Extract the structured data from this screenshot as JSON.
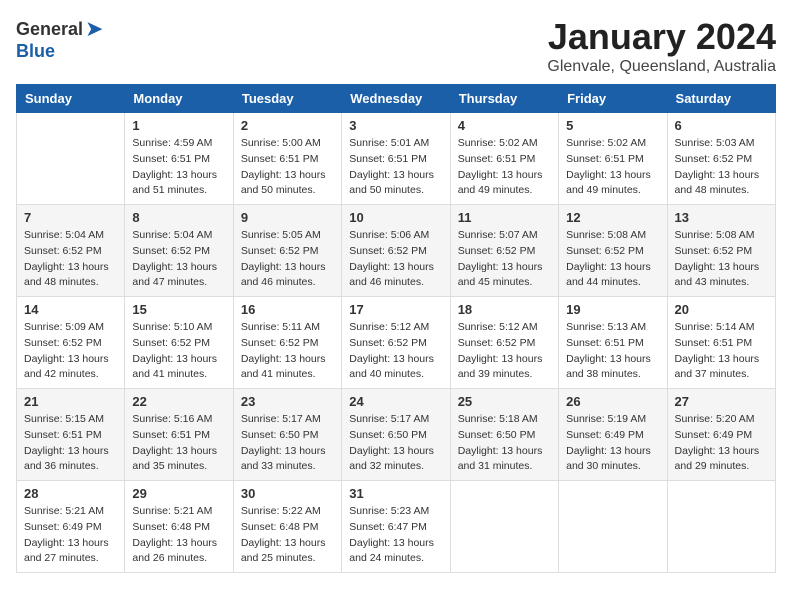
{
  "header": {
    "logo_general": "General",
    "logo_blue": "Blue",
    "month_title": "January 2024",
    "location": "Glenvale, Queensland, Australia"
  },
  "weekdays": [
    "Sunday",
    "Monday",
    "Tuesday",
    "Wednesday",
    "Thursday",
    "Friday",
    "Saturday"
  ],
  "weeks": [
    [
      {
        "day": "",
        "sunrise": "",
        "sunset": "",
        "daylight": ""
      },
      {
        "day": "1",
        "sunrise": "Sunrise: 4:59 AM",
        "sunset": "Sunset: 6:51 PM",
        "daylight": "Daylight: 13 hours and 51 minutes."
      },
      {
        "day": "2",
        "sunrise": "Sunrise: 5:00 AM",
        "sunset": "Sunset: 6:51 PM",
        "daylight": "Daylight: 13 hours and 50 minutes."
      },
      {
        "day": "3",
        "sunrise": "Sunrise: 5:01 AM",
        "sunset": "Sunset: 6:51 PM",
        "daylight": "Daylight: 13 hours and 50 minutes."
      },
      {
        "day": "4",
        "sunrise": "Sunrise: 5:02 AM",
        "sunset": "Sunset: 6:51 PM",
        "daylight": "Daylight: 13 hours and 49 minutes."
      },
      {
        "day": "5",
        "sunrise": "Sunrise: 5:02 AM",
        "sunset": "Sunset: 6:51 PM",
        "daylight": "Daylight: 13 hours and 49 minutes."
      },
      {
        "day": "6",
        "sunrise": "Sunrise: 5:03 AM",
        "sunset": "Sunset: 6:52 PM",
        "daylight": "Daylight: 13 hours and 48 minutes."
      }
    ],
    [
      {
        "day": "7",
        "sunrise": "Sunrise: 5:04 AM",
        "sunset": "Sunset: 6:52 PM",
        "daylight": "Daylight: 13 hours and 48 minutes."
      },
      {
        "day": "8",
        "sunrise": "Sunrise: 5:04 AM",
        "sunset": "Sunset: 6:52 PM",
        "daylight": "Daylight: 13 hours and 47 minutes."
      },
      {
        "day": "9",
        "sunrise": "Sunrise: 5:05 AM",
        "sunset": "Sunset: 6:52 PM",
        "daylight": "Daylight: 13 hours and 46 minutes."
      },
      {
        "day": "10",
        "sunrise": "Sunrise: 5:06 AM",
        "sunset": "Sunset: 6:52 PM",
        "daylight": "Daylight: 13 hours and 46 minutes."
      },
      {
        "day": "11",
        "sunrise": "Sunrise: 5:07 AM",
        "sunset": "Sunset: 6:52 PM",
        "daylight": "Daylight: 13 hours and 45 minutes."
      },
      {
        "day": "12",
        "sunrise": "Sunrise: 5:08 AM",
        "sunset": "Sunset: 6:52 PM",
        "daylight": "Daylight: 13 hours and 44 minutes."
      },
      {
        "day": "13",
        "sunrise": "Sunrise: 5:08 AM",
        "sunset": "Sunset: 6:52 PM",
        "daylight": "Daylight: 13 hours and 43 minutes."
      }
    ],
    [
      {
        "day": "14",
        "sunrise": "Sunrise: 5:09 AM",
        "sunset": "Sunset: 6:52 PM",
        "daylight": "Daylight: 13 hours and 42 minutes."
      },
      {
        "day": "15",
        "sunrise": "Sunrise: 5:10 AM",
        "sunset": "Sunset: 6:52 PM",
        "daylight": "Daylight: 13 hours and 41 minutes."
      },
      {
        "day": "16",
        "sunrise": "Sunrise: 5:11 AM",
        "sunset": "Sunset: 6:52 PM",
        "daylight": "Daylight: 13 hours and 41 minutes."
      },
      {
        "day": "17",
        "sunrise": "Sunrise: 5:12 AM",
        "sunset": "Sunset: 6:52 PM",
        "daylight": "Daylight: 13 hours and 40 minutes."
      },
      {
        "day": "18",
        "sunrise": "Sunrise: 5:12 AM",
        "sunset": "Sunset: 6:52 PM",
        "daylight": "Daylight: 13 hours and 39 minutes."
      },
      {
        "day": "19",
        "sunrise": "Sunrise: 5:13 AM",
        "sunset": "Sunset: 6:51 PM",
        "daylight": "Daylight: 13 hours and 38 minutes."
      },
      {
        "day": "20",
        "sunrise": "Sunrise: 5:14 AM",
        "sunset": "Sunset: 6:51 PM",
        "daylight": "Daylight: 13 hours and 37 minutes."
      }
    ],
    [
      {
        "day": "21",
        "sunrise": "Sunrise: 5:15 AM",
        "sunset": "Sunset: 6:51 PM",
        "daylight": "Daylight: 13 hours and 36 minutes."
      },
      {
        "day": "22",
        "sunrise": "Sunrise: 5:16 AM",
        "sunset": "Sunset: 6:51 PM",
        "daylight": "Daylight: 13 hours and 35 minutes."
      },
      {
        "day": "23",
        "sunrise": "Sunrise: 5:17 AM",
        "sunset": "Sunset: 6:50 PM",
        "daylight": "Daylight: 13 hours and 33 minutes."
      },
      {
        "day": "24",
        "sunrise": "Sunrise: 5:17 AM",
        "sunset": "Sunset: 6:50 PM",
        "daylight": "Daylight: 13 hours and 32 minutes."
      },
      {
        "day": "25",
        "sunrise": "Sunrise: 5:18 AM",
        "sunset": "Sunset: 6:50 PM",
        "daylight": "Daylight: 13 hours and 31 minutes."
      },
      {
        "day": "26",
        "sunrise": "Sunrise: 5:19 AM",
        "sunset": "Sunset: 6:49 PM",
        "daylight": "Daylight: 13 hours and 30 minutes."
      },
      {
        "day": "27",
        "sunrise": "Sunrise: 5:20 AM",
        "sunset": "Sunset: 6:49 PM",
        "daylight": "Daylight: 13 hours and 29 minutes."
      }
    ],
    [
      {
        "day": "28",
        "sunrise": "Sunrise: 5:21 AM",
        "sunset": "Sunset: 6:49 PM",
        "daylight": "Daylight: 13 hours and 27 minutes."
      },
      {
        "day": "29",
        "sunrise": "Sunrise: 5:21 AM",
        "sunset": "Sunset: 6:48 PM",
        "daylight": "Daylight: 13 hours and 26 minutes."
      },
      {
        "day": "30",
        "sunrise": "Sunrise: 5:22 AM",
        "sunset": "Sunset: 6:48 PM",
        "daylight": "Daylight: 13 hours and 25 minutes."
      },
      {
        "day": "31",
        "sunrise": "Sunrise: 5:23 AM",
        "sunset": "Sunset: 6:47 PM",
        "daylight": "Daylight: 13 hours and 24 minutes."
      },
      {
        "day": "",
        "sunrise": "",
        "sunset": "",
        "daylight": ""
      },
      {
        "day": "",
        "sunrise": "",
        "sunset": "",
        "daylight": ""
      },
      {
        "day": "",
        "sunrise": "",
        "sunset": "",
        "daylight": ""
      }
    ]
  ]
}
